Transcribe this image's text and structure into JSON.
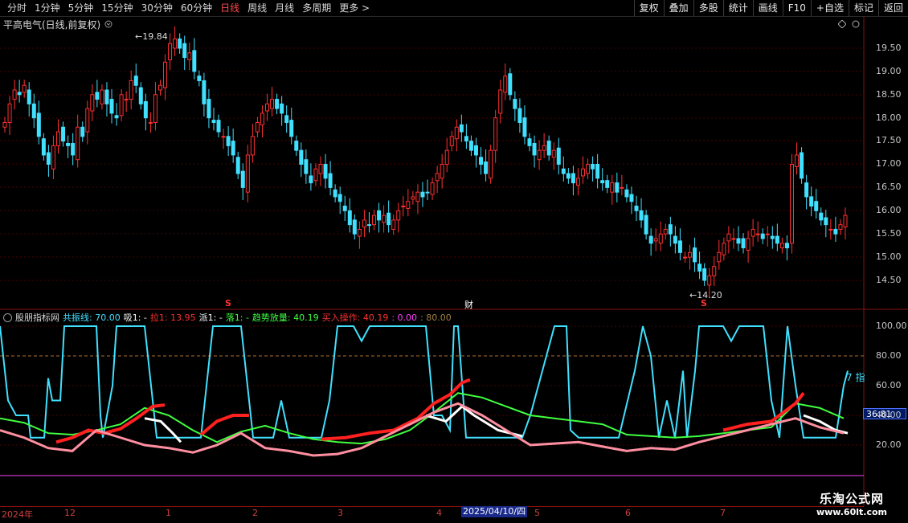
{
  "toolbar": {
    "periods": [
      "分时",
      "1分钟",
      "5分钟",
      "15分钟",
      "30分钟",
      "60分钟",
      "日线",
      "周线",
      "月线",
      "多周期",
      "更多 >"
    ],
    "active_period": "日线",
    "actions": [
      "复权",
      "叠加",
      "多股",
      "统计",
      "画线",
      "F10",
      "+自选",
      "标记",
      "返回"
    ]
  },
  "main_chart": {
    "title": "平高电气(日线,前复权)",
    "price_axis": [
      "19.50",
      "19.00",
      "18.50",
      "18.00",
      "17.50",
      "17.00",
      "16.50",
      "16.00",
      "15.50",
      "15.00",
      "14.50"
    ],
    "high_label": "19.84",
    "low_label": "14.20",
    "markers": {
      "s1": "S",
      "cai": "财",
      "s2": "S"
    }
  },
  "indicator": {
    "name": "股朋指标网",
    "legend": [
      {
        "text": "共振线: 70.00",
        "color": "#40e0ff"
      },
      {
        "text": "吸1: -",
        "color": "#ffffff"
      },
      {
        "text": "拉1: 13.95",
        "color": "#ff3030"
      },
      {
        "text": "派1: -",
        "color": "#ffffff"
      },
      {
        "text": "落1: -",
        "color": "#40ff40"
      },
      {
        "text": "趋势放量: 40.19",
        "color": "#40ff40"
      },
      {
        "text": "买入操作: 40.19",
        "color": "#ff3030"
      },
      {
        "text": ": 0.00",
        "color": "#ff40ff"
      },
      {
        "text": ": 80.00",
        "color": "#a08040"
      }
    ],
    "axis": [
      "100.00",
      "80.00",
      "60.00",
      "40.00",
      "20.00"
    ],
    "current_value": "36.81",
    "side_text": "7 指"
  },
  "date_axis": {
    "labels": [
      "2024年",
      "12",
      "1",
      "2",
      "3",
      "4",
      "5",
      "6",
      "7"
    ],
    "highlight": "2025/04/10/四"
  },
  "watermark": {
    "line1": "乐淘公式网",
    "line2": "www.60lt.com"
  },
  "colors": {
    "up": "#ff3030",
    "down": "#40e0ff",
    "grid": "#5a0000",
    "accent": "#ff3030"
  }
}
